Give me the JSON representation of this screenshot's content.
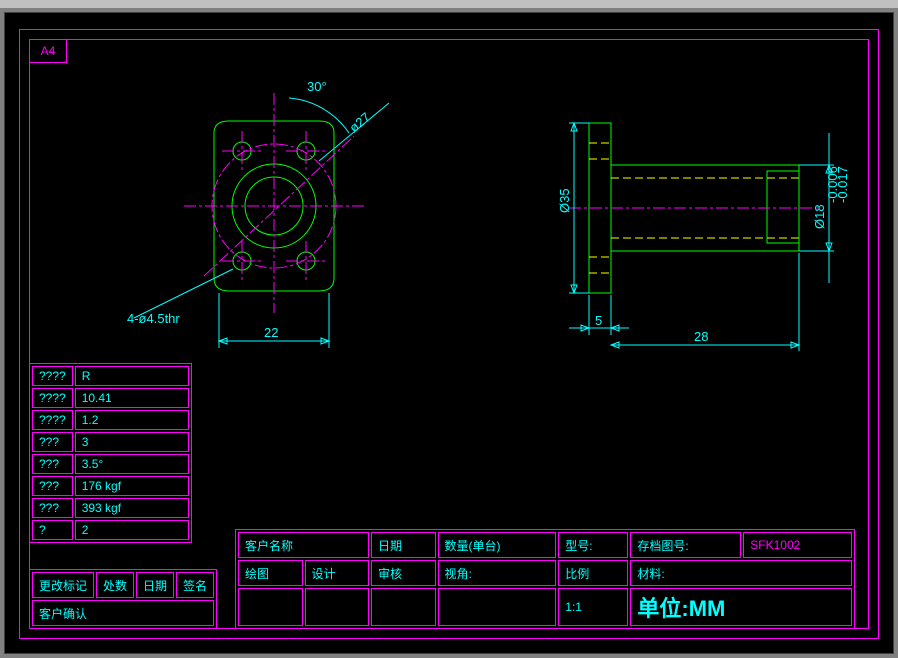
{
  "paper": "A4",
  "dims": {
    "angle": "30°",
    "dia27": "ø27",
    "holes": "4-ø4.5thr",
    "w22": "22",
    "d35": "Ø35",
    "t5": "5",
    "l28": "28",
    "d18": "Ø18",
    "tol1": "-0.006",
    "tol2": "-0.017"
  },
  "specs": [
    [
      "????",
      "R"
    ],
    [
      "????",
      "10.41"
    ],
    [
      "????",
      "1.2"
    ],
    [
      "???",
      "3"
    ],
    [
      "???",
      "3.5°"
    ],
    [
      "???",
      "176 kgf"
    ],
    [
      "???",
      "393 kgf"
    ],
    [
      "?",
      "2"
    ]
  ],
  "tb1": {
    "r1": [
      "更改标记",
      "处数",
      "日期",
      "签名"
    ],
    "r2": "客户确认"
  },
  "tb2": {
    "h": [
      "客户名称",
      "日期",
      "数量(单台)",
      "型号:",
      "存档图号:"
    ],
    "num": "SFK1002",
    "r2": [
      "绘图",
      "设计",
      "审核",
      "视角:",
      "比例"
    ],
    "scale": "1:1",
    "mat": "材料:",
    "unit": "单位:MM"
  },
  "chart_data": {
    "type": "table",
    "title": "Mechanical Drawing SFK1002",
    "views": [
      "front",
      "side"
    ],
    "dimensions": {
      "width": 22,
      "length": 28,
      "flange_thickness": 5,
      "outer_dia": 35,
      "bore_dia": 27,
      "shaft_dia": 18,
      "shaft_tol": [
        -0.006,
        -0.017
      ],
      "bolt_holes": 4,
      "bolt_dia": 4.5,
      "angle": 30
    },
    "specs": {
      "precision": "R",
      "val1": 10.41,
      "val2": 1.2,
      "val3": 3,
      "lead_angle": 3.5,
      "load1_kgf": 176,
      "load2_kgf": 393,
      "qty": 2
    },
    "scale": "1:1",
    "units": "MM"
  }
}
